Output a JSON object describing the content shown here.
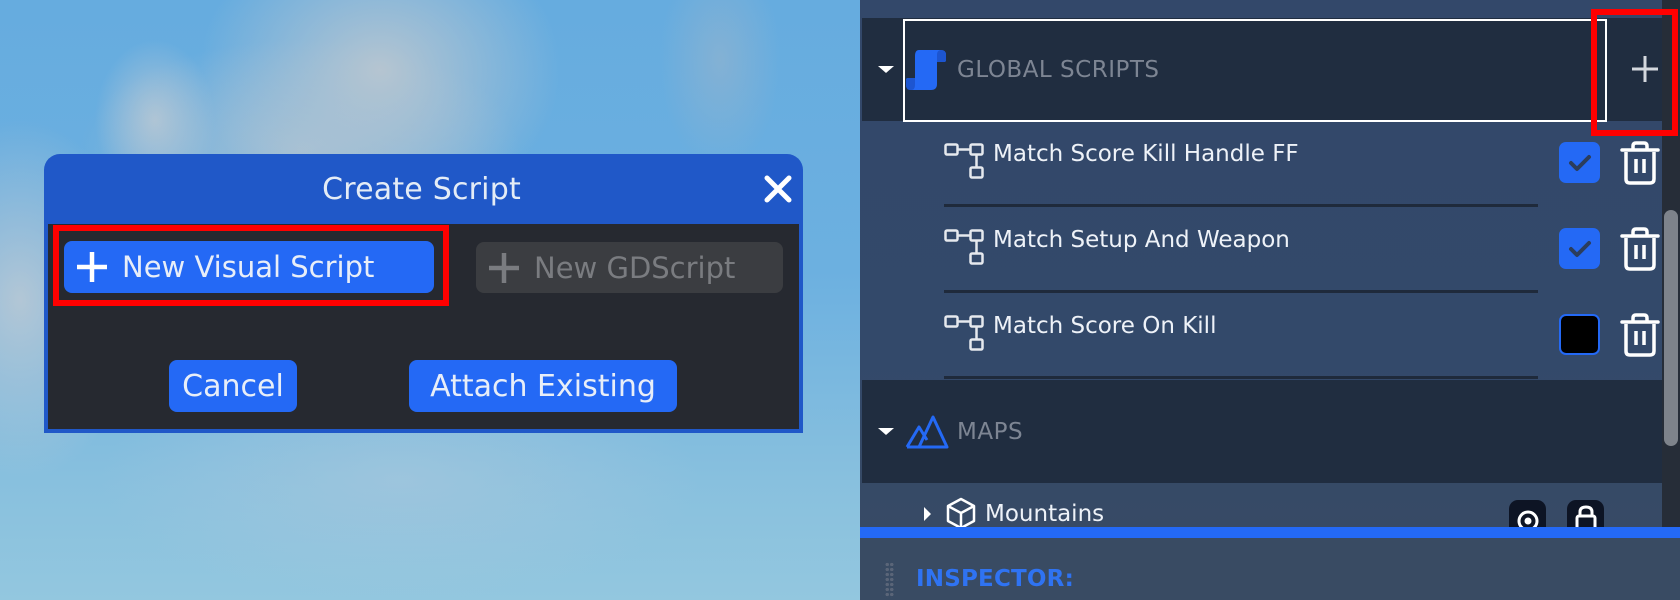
{
  "dialog": {
    "title": "Create Script",
    "buttons": {
      "new_visual_script": "New Visual Script",
      "new_gdscript": "New GDScript",
      "cancel": "Cancel",
      "attach_existing": "Attach Existing"
    },
    "new_gdscript_enabled": false,
    "highlighted_button": "new_visual_script"
  },
  "scene_tree": {
    "groups": [
      {
        "title": "GLOBAL SCRIPTS",
        "icon": "scroll-icon",
        "expanded": true,
        "selected": true,
        "add_button_highlighted": true,
        "items": [
          {
            "name": "Match Score Kill Handle FF",
            "icon": "visual-script-icon",
            "enabled": true
          },
          {
            "name": "Match Setup And Weapon",
            "icon": "visual-script-icon",
            "enabled": true
          },
          {
            "name": "Match Score On Kill",
            "icon": "visual-script-icon",
            "enabled": false
          }
        ]
      },
      {
        "title": "MAPS",
        "icon": "mountain-icon",
        "expanded": true,
        "items": [
          {
            "name": "Mountains",
            "icon": "cube-icon",
            "collapsed": true
          }
        ]
      }
    ]
  },
  "inspector": {
    "title": "INSPECTOR:"
  },
  "colors": {
    "accent": "#2469f5",
    "dialog_header": "#2058c8",
    "dialog_body": "#262930",
    "panel_bg": "#33496a",
    "group_header_bg": "#202d40",
    "highlight": "#ff0000"
  }
}
